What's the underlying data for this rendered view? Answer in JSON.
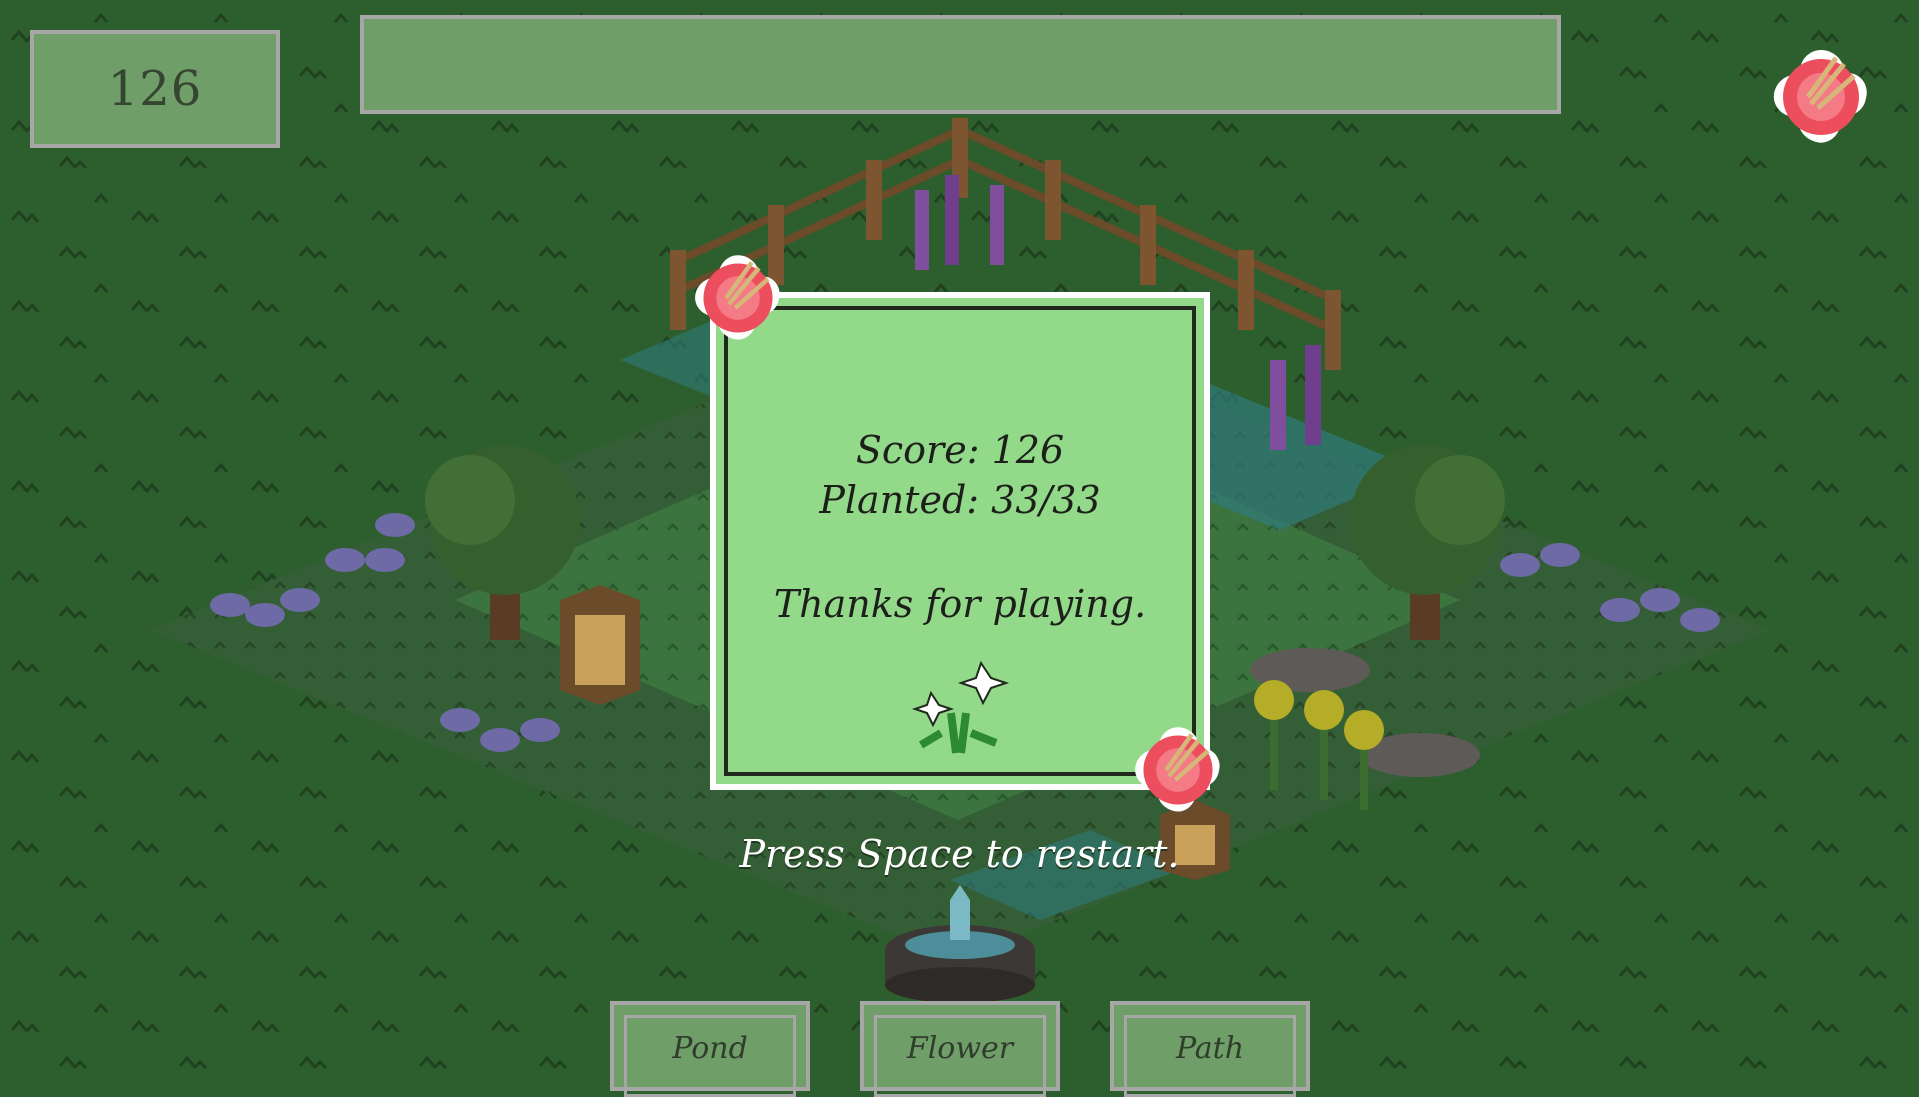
{
  "hud": {
    "score_display": "126",
    "progress_fraction": 0.0
  },
  "end_screen": {
    "score_line": "Score: 126",
    "planted_line": "Planted: 33/33",
    "thanks_line": "Thanks for playing.",
    "restart_hint": "Press Space to restart."
  },
  "toolbar": {
    "pond_label": "Pond",
    "flower_label": "Flower",
    "path_label": "Path"
  },
  "icons": {
    "corner_flower": "hibiscus-icon",
    "modal_flower": "lily-icon"
  },
  "colors": {
    "background": "#2d5e2d",
    "panel": "#6f9e68",
    "modal": "#93d98a",
    "border": "#a7a7a7",
    "hibiscus": "#ec4e5e"
  }
}
